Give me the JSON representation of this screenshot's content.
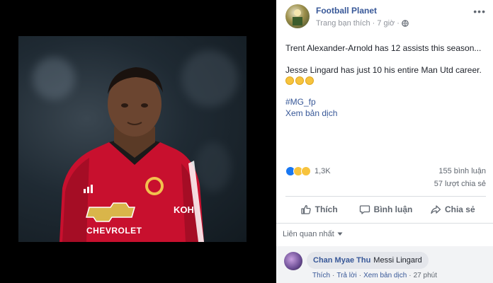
{
  "post": {
    "page_name": "Football Planet",
    "meta_label": "Trang bạn thích",
    "time": "7 giờ",
    "line1": "Trent Alexander-Arnold has 12 assists this season...",
    "line2": "Jesse Lingard has just 10 his entire Man Utd career.",
    "hashtag": "#MG_fp",
    "translate_label": "Xem bản dịch"
  },
  "photo": {
    "sponsor_text": "KOH",
    "chevrolet_text": "CHEVROLET"
  },
  "stats": {
    "reactions_count": "1,3K",
    "comments_count": "155 bình luận",
    "shares_count": "57 lượt chia sẻ"
  },
  "actions": {
    "like_label": "Thích",
    "comment_label": "Bình luận",
    "share_label": "Chia sẻ"
  },
  "comments": {
    "sort_label": "Liên quan nhất",
    "items": [
      {
        "author": "Chan Myae Thu",
        "text": "Messi Lingard",
        "like": "Thích",
        "reply": "Trả lời",
        "translate": "Xem bản dịch",
        "time": "27 phút"
      }
    ]
  },
  "colors": {
    "link_blue": "#385898",
    "kit_red": "#c8102e",
    "like_blue": "#1877f2"
  },
  "icons": [
    "more-icon",
    "globe-icon",
    "like-icon",
    "comment-icon",
    "share-icon",
    "caret-down-icon"
  ]
}
